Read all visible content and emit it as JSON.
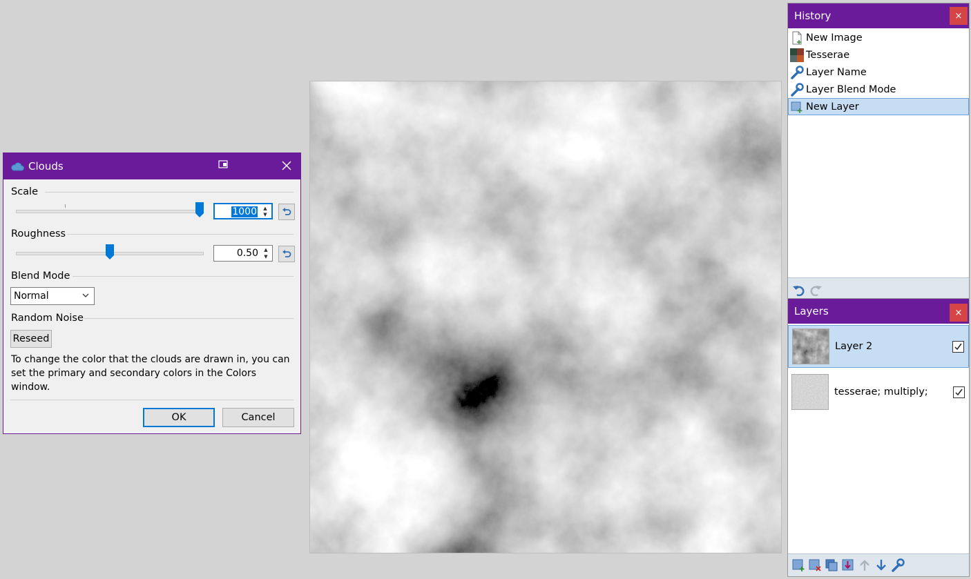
{
  "clouds_dialog": {
    "title": "Clouds",
    "scale_label": "Scale",
    "scale_value": "1000",
    "roughness_label": "Roughness",
    "roughness_value": "0.50",
    "blend_mode_label": "Blend Mode",
    "blend_mode_value": "Normal",
    "random_noise_label": "Random Noise",
    "reseed_label": "Reseed",
    "description": "To change the color that the clouds are drawn in, you can set the primary and secondary colors in the Colors window.",
    "ok_label": "OK",
    "cancel_label": "Cancel"
  },
  "history": {
    "title": "History",
    "close_label": "×",
    "items": [
      {
        "label": "New Image",
        "icon": "new-image-icon"
      },
      {
        "label": "Tesserae",
        "icon": "tesserae-icon"
      },
      {
        "label": "Layer Name",
        "icon": "wrench-icon"
      },
      {
        "label": "Layer Blend Mode",
        "icon": "wrench-icon"
      },
      {
        "label": "New Layer",
        "icon": "new-layer-icon",
        "selected": true
      }
    ]
  },
  "layers": {
    "title": "Layers",
    "close_label": "×",
    "items": [
      {
        "name": "Layer 2",
        "visible": true,
        "selected": true
      },
      {
        "name": "tesserae; multiply;",
        "visible": true,
        "selected": false
      }
    ]
  },
  "colors": {
    "title_bar": "#6a1b9a",
    "selection": "#c7ddf3",
    "accent": "#0078d7",
    "close_red": "#d64545"
  }
}
